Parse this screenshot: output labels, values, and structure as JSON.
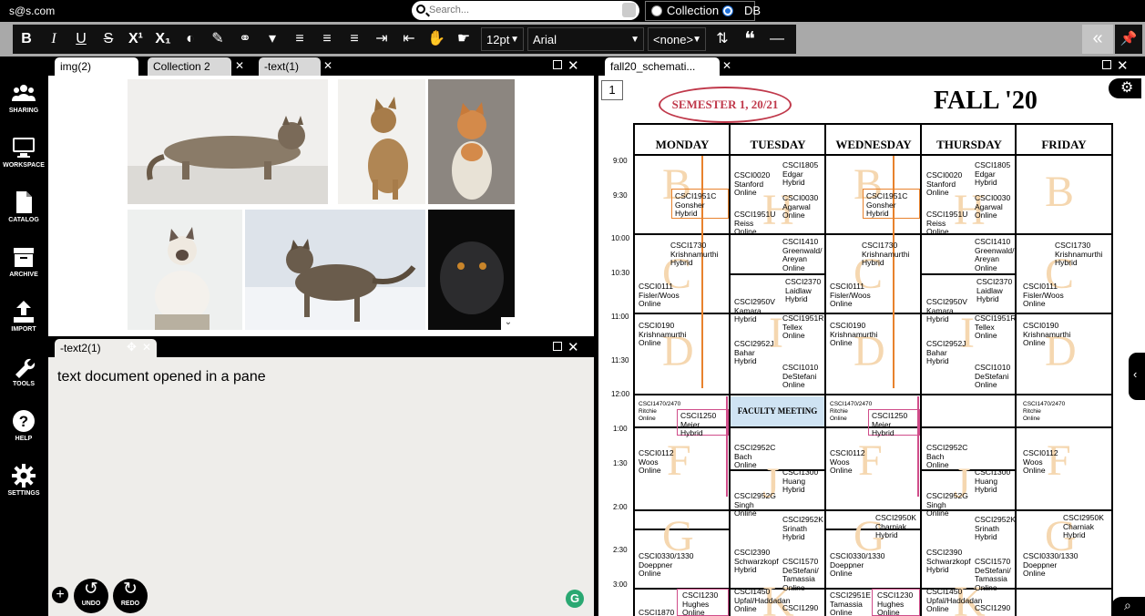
{
  "topbar": {
    "user": "s@s.com",
    "search_placeholder": "Search...",
    "scope_collection": "Collection",
    "scope_db": "DB",
    "scope_selected": "DB"
  },
  "toolbar": {
    "buttons": [
      "bold",
      "italic",
      "underline",
      "strikethrough",
      "superscript",
      "subscript",
      "text-color",
      "highlight",
      "link",
      "format-painter",
      "align-left",
      "align-center",
      "align-right",
      "indent",
      "outdent",
      "hand",
      "pointer"
    ],
    "font_size": "12pt",
    "font_family": "Arial",
    "style": "<none>",
    "collapse_label": "«"
  },
  "sidebar": {
    "items": [
      {
        "label": "SHARING",
        "icon": "users-icon"
      },
      {
        "label": "WORKSPACE",
        "icon": "monitor-icon"
      },
      {
        "label": "CATALOG",
        "icon": "document-icon"
      },
      {
        "label": "ARCHIVE",
        "icon": "archive-icon"
      },
      {
        "label": "IMPORT",
        "icon": "upload-icon"
      },
      {
        "label": "TOOLS",
        "icon": "wrench-icon"
      },
      {
        "label": "HELP",
        "icon": "help-icon"
      },
      {
        "label": "SETTINGS",
        "icon": "gear-icon"
      }
    ]
  },
  "pane_top": {
    "tabs": [
      {
        "label": "img(2)",
        "active": true
      },
      {
        "label": "Collection 2",
        "active": false
      },
      {
        "label": "-text(1)",
        "active": false
      }
    ]
  },
  "pane_bottom": {
    "tab": "-text2(1)",
    "body": "text document opened in a pane",
    "undo_label": "UNDO",
    "redo_label": "REDO"
  },
  "pane_right": {
    "tab": "fall20_schemati...",
    "page_number": "1",
    "schedule": {
      "semester": "SEMESTER 1, 20/21",
      "title": "FALL '20",
      "days": [
        "MONDAY",
        "TUESDAY",
        "WEDNESDAY",
        "THURSDAY",
        "FRIDAY"
      ],
      "times": [
        "9:00",
        "9:30",
        "10:00",
        "10:30",
        "11:00",
        "11:30",
        "12:00",
        "1:00",
        "1:30",
        "2:00",
        "2:30",
        "3:00"
      ],
      "faculty_meeting": "FACULTY MEETING",
      "courses": {
        "mon_b": "CSCI1951C\nGonsher\nHybrid",
        "mon_c1": "CSCI1730\nKrishnamurthi\nHybrid",
        "mon_c2": "CSCI0111\nFisler/Woos\nOnline",
        "mon_d": "CSCI0190\nKrishnamurthi\nOnline",
        "mon_noon": "CSCI1470/2470\nRitchie\nOnline",
        "mon_1250": "CSCI1250\nMeier\nHybrid",
        "mon_f": "CSCI0112\nWoos\nOnline",
        "mon_g": "CSCI0330/1330\nDoeppner\nOnline",
        "mon_h1": "CSCI1230\nHughes\nOnline",
        "mon_h2": "CSCI1870",
        "tue_a1": "CSCI0020\nStanford\nOnline",
        "tue_a2": "CSCI1805\nEdgar\nHybrid",
        "tue_a3": "CSCI0030\nAgarwal\nOnline",
        "tue_a4": "CSCI1951U\nReiss\nOnline",
        "tue_b1": "CSCI1410\nGreenwald/\nAreyan\nOnline",
        "tue_b2": "CSCI2370\nLaidlaw\nHybrid",
        "tue_b3": "CSCI2950V\nKamara\nHybrid",
        "tue_b4": "CSCI1951R\nTellex\nOnline",
        "tue_b5": "CSCI2952J\nBahar\nHybrid",
        "tue_b6": "CSCI1010\nDeStefani\nOnline",
        "tue_c1": "CSCI2952C\nBach\nOnline",
        "tue_c2": "CSCI1300\nHuang\nHybrid",
        "tue_c3": "CSCI2952G\nSingh\nOnline",
        "tue_c4": "CSCI2952K\nSrinath\nHybrid",
        "tue_d1": "CSCI2390\nSchwarzkopf\nHybrid",
        "tue_d2": "CSCI1570\nDeStefani/\nTamassia\nOnline",
        "tue_d3": "CSCI1450\nUpfal/Haddadan\nOnline",
        "tue_d4": "CSCI1290",
        "wed_b": "CSCI1951C\nGonsher\nHybrid",
        "wed_c1": "CSCI1730\nKrishnamurthi\nHybrid",
        "wed_c2": "CSCI0111\nFisler/Woos\nOnline",
        "wed_d": "CSCI0190\nKrishnamurthi\nOnline",
        "wed_noon": "CSCI1470/2470\nRitchie\nOnline",
        "wed_1250": "CSCI1250\nMeier\nHybrid",
        "wed_f": "CSCI0112\nWoos\nOnline",
        "wed_g1": "CSCI2950K\nCharniak\nHybrid",
        "wed_g2": "CSCI0330/1330\nDoeppner\nOnline",
        "wed_h1": "CSCI2951E\nTamassia\nOnline",
        "wed_h2": "CSCI1230\nHughes\nOnline",
        "thu_a1": "CSCI0020\nStanford\nOnline",
        "thu_a2": "CSCI1805\nEdgar\nHybrid",
        "thu_a3": "CSCI0030\nAgarwal\nOnline",
        "thu_a4": "CSCI1951U\nReiss\nOnline",
        "thu_b1": "CSCI1410\nGreenwald/\nAreyan\nOnline",
        "thu_b2": "CSCI2370\nLaidlaw\nHybrid",
        "thu_b3": "CSCI2950V\nKamara\nHybrid",
        "thu_b4": "CSCI1951R\nTellex\nOnline",
        "thu_b5": "CSCI2952J\nBahar\nHybrid",
        "thu_b6": "CSCI1010\nDeStefani\nOnline",
        "thu_c1": "CSCI2952C\nBach\nOnline",
        "thu_c2": "CSCI1300\nHuang\nHybrid",
        "thu_c3": "CSCI2952G\nSingh\nOnline",
        "thu_c4": "CSCI2952K\nSrinath\nHybrid",
        "thu_d1": "CSCI2390\nSchwarzkopf\nHybrid",
        "thu_d2": "CSCI1570\nDeStefani/\nTamassia\nOnline",
        "thu_d3": "CSCI1450\nUpfal/Haddadan\nOnline",
        "thu_d4": "CSCI1290",
        "fri_c1": "CSCI1730\nKrishnamurthi\nHybrid",
        "fri_c2": "CSCI0111\nFisler/Woos\nOnline",
        "fri_d": "CSCI0190\nKrishnamurthi\nOnline",
        "fri_noon": "CSCI1470/2470\nRitchie\nOnline",
        "fri_f": "CSCI0112\nWoos\nOnline",
        "fri_g1": "CSCI2950K\nCharniak\nHybrid",
        "fri_g2": "CSCI0330/1330\nDoeppner\nOnline"
      },
      "slot_letters": [
        "B",
        "C",
        "D",
        "F",
        "G",
        "H",
        "I",
        "J",
        "K"
      ]
    }
  },
  "colors": {
    "toolbar_bg": "#a9a9a9",
    "accent_blue": "#1e6fd8",
    "schedule_title_red": "#c0394b",
    "slot_letter": "#f5d7b0",
    "orange_box": "#e8822d",
    "pink_box": "#d04d8a",
    "meeting_bg": "#cfe3f3"
  }
}
